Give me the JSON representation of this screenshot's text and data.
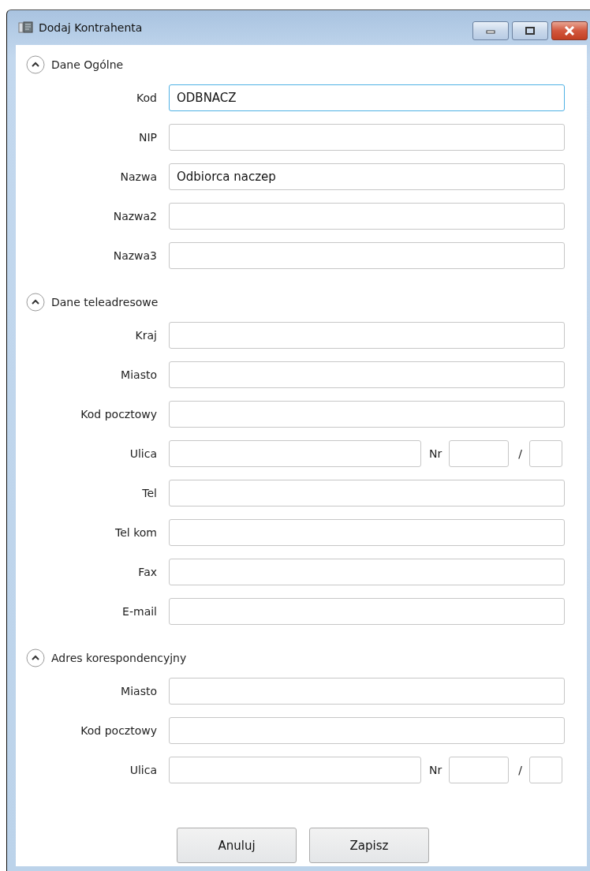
{
  "window": {
    "title": "Dodaj Kontrahenta"
  },
  "sections": [
    {
      "title": "Dane Ogólne",
      "expanded": true,
      "fields": [
        {
          "kind": "text",
          "label": "Kod",
          "value": "ODBNACZ",
          "focused": true
        },
        {
          "kind": "text",
          "label": "NIP",
          "focused": false
        },
        {
          "kind": "text",
          "label": "Nazwa",
          "value": "Odbiorca naczep",
          "focused": false
        },
        {
          "kind": "text",
          "label": "Nazwa2",
          "focused": false
        },
        {
          "kind": "text",
          "label": "Nazwa3",
          "focused": false
        }
      ]
    },
    {
      "title": "Dane teleadresowe",
      "expanded": true,
      "fields": [
        {
          "kind": "text",
          "label": "Kraj",
          "focused": false
        },
        {
          "kind": "text",
          "label": "Miasto",
          "focused": false
        },
        {
          "kind": "text",
          "label": "Kod pocztowy",
          "focused": false
        },
        {
          "kind": "address",
          "label": "Ulica",
          "nr_label": "Nr",
          "separator": "/",
          "focused": false
        },
        {
          "kind": "text",
          "label": "Tel",
          "focused": false
        },
        {
          "kind": "text",
          "label": "Tel kom",
          "focused": false
        },
        {
          "kind": "text",
          "label": "Fax",
          "focused": false
        },
        {
          "kind": "text",
          "label": "E-mail",
          "focused": false
        }
      ]
    },
    {
      "title": "Adres korespondencyjny",
      "expanded": true,
      "fields": [
        {
          "kind": "text",
          "label": "Miasto",
          "focused": false
        },
        {
          "kind": "text",
          "label": "Kod pocztowy",
          "focused": false
        },
        {
          "kind": "address",
          "label": "Ulica",
          "nr_label": "Nr",
          "separator": "/",
          "focused": false
        }
      ]
    }
  ],
  "buttons": [
    "Anuluj",
    "Zapisz"
  ]
}
